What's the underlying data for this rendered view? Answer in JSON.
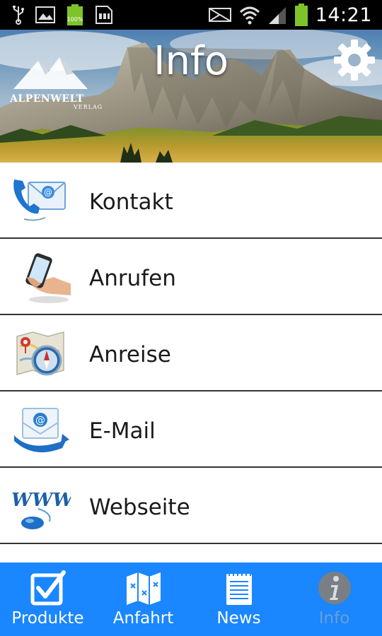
{
  "status_bar": {
    "battery_small": "100%",
    "time": "14:21"
  },
  "header": {
    "title": "Info",
    "logo_text": "ALPENWELT",
    "logo_subtext": "VERLAG",
    "settings_icon": "gear-icon"
  },
  "list": {
    "items": [
      {
        "label": "Kontakt",
        "icon": "contact-phone-mail-icon"
      },
      {
        "label": "Anrufen",
        "icon": "smartphone-hand-icon"
      },
      {
        "label": "Anreise",
        "icon": "map-compass-icon"
      },
      {
        "label": "E-Mail",
        "icon": "email-icon"
      },
      {
        "label": "Webseite",
        "icon": "www-mouse-icon"
      }
    ]
  },
  "bottom_nav": {
    "items": [
      {
        "label": "Produkte",
        "icon": "checkbox-icon",
        "active": false
      },
      {
        "label": "Anfahrt",
        "icon": "map-icon",
        "active": false
      },
      {
        "label": "News",
        "icon": "notepad-icon",
        "active": false
      },
      {
        "label": "Info",
        "icon": "info-icon",
        "active": true
      }
    ]
  },
  "colors": {
    "nav_background": "#1a86ff",
    "nav_active_text": "#6a9fd6",
    "status_bar": "#000000",
    "battery": "#7dc42a"
  }
}
